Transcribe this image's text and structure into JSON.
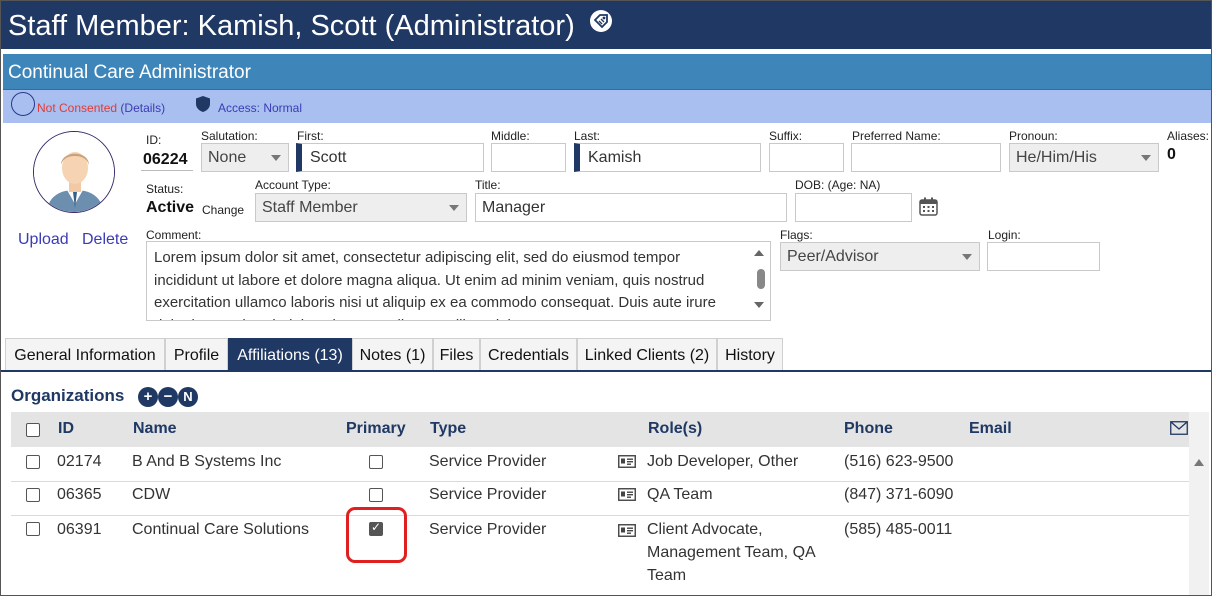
{
  "header": {
    "title": "Staff Member: Kamish, Scott (Administrator)",
    "tag_icon": "tag-icon",
    "subtitle": "Continual Care Administrator"
  },
  "status_bar": {
    "consent_text": "Not Consented",
    "consent_details": "(Details)",
    "access_text": "Access: Normal"
  },
  "photo": {
    "upload": "Upload",
    "delete": "Delete"
  },
  "profile": {
    "id_label": "ID:",
    "id_value": "06224",
    "salutation_label": "Salutation:",
    "salutation_value": "None",
    "first_label": "First:",
    "first_value": "Scott",
    "middle_label": "Middle:",
    "middle_value": "",
    "last_label": "Last:",
    "last_value": "Kamish",
    "suffix_label": "Suffix:",
    "suffix_value": "",
    "preferred_label": "Preferred Name:",
    "preferred_value": "",
    "pronoun_label": "Pronoun:",
    "pronoun_value": "He/Him/His",
    "aliases_label": "Aliases:",
    "aliases_value": "0",
    "status_label": "Status:",
    "status_value": "Active",
    "status_change": "Change",
    "account_type_label": "Account Type:",
    "account_type_value": "Staff Member",
    "title_label": "Title:",
    "title_value": "Manager",
    "dob_label": "DOB: (Age: NA)",
    "dob_value": "",
    "comment_label": "Comment:",
    "comment_value": "Lorem ipsum dolor sit amet, consectetur adipiscing elit, sed do eiusmod tempor incididunt ut labore et dolore magna aliqua. Ut enim ad minim veniam, quis nostrud exercitation ullamco laboris nisi ut aliquip ex ea commodo consequat. Duis aute irure dolor in reprehenderit in voluptate velit esse cillum dolore eu",
    "flags_label": "Flags:",
    "flags_value": "Peer/Advisor",
    "login_label": "Login:",
    "login_value": ""
  },
  "tabs": [
    {
      "label": "General Information"
    },
    {
      "label": "Profile"
    },
    {
      "label": "Affiliations (13)"
    },
    {
      "label": "Notes (1)"
    },
    {
      "label": "Files"
    },
    {
      "label": "Credentials"
    },
    {
      "label": "Linked Clients (2)"
    },
    {
      "label": "History"
    }
  ],
  "active_tab": "Affiliations (13)",
  "organizations": {
    "title": "Organizations",
    "buttons": [
      "+",
      "−",
      "N"
    ],
    "columns": {
      "id": "ID",
      "name": "Name",
      "primary": "Primary",
      "type": "Type",
      "roles": "Role(s)",
      "phone": "Phone",
      "email": "Email"
    },
    "rows": [
      {
        "id": "02174",
        "name": "B And B Systems Inc",
        "primary": false,
        "type": "Service Provider",
        "roles": [
          "Job Developer, Other"
        ],
        "phone": "(516) 623-9500",
        "email": ""
      },
      {
        "id": "06365",
        "name": "CDW",
        "primary": false,
        "type": "Service Provider",
        "roles": [
          "QA Team"
        ],
        "phone": "(847) 371-6090",
        "email": ""
      },
      {
        "id": "06391",
        "name": "Continual Care Solutions",
        "primary": true,
        "type": "Service Provider",
        "roles": [
          "Client Advocate,",
          "Management Team, QA",
          "Team"
        ],
        "phone": "(585) 485-0011",
        "email": ""
      }
    ]
  },
  "colors": {
    "title_bg": "#1f3864",
    "subtitle_bg": "#3e86b9",
    "status_bg": "#a8bff0",
    "highlight": "#e02020"
  }
}
